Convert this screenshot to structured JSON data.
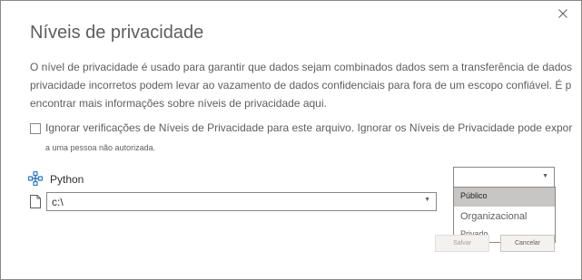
{
  "dialog": {
    "title": "Níveis de privacidade",
    "description_lines": [
      "O nível de privacidade é usado para garantir que dados sejam combinados dados sem a transferência de dados",
      "privacidade incorretos podem levar ao vazamento de dados confidenciais para fora de um escopo confiável. É p",
      "encontrar mais informações sobre níveis de privacidade aqui."
    ],
    "ignore": {
      "label": "Ignorar verificações de Níveis de Privacidade para este arquivo. Ignorar os Níveis de Privacidade pode expor",
      "label_continued": "a uma pessoa não autorizada.",
      "checked": false
    },
    "source": {
      "name": "Python",
      "icon": "python-connector-icon",
      "path_value": "c:\\"
    },
    "privacy_select": {
      "selected": "",
      "options": [
        "Público",
        "Organizacional",
        "Privado"
      ],
      "highlighted": "Público"
    },
    "buttons": {
      "save": "Salvar",
      "cancel": "Cancelar"
    },
    "colors": {
      "highlight": "#c8c6c4",
      "border": "#8a8886",
      "text": "#605e5c"
    }
  }
}
